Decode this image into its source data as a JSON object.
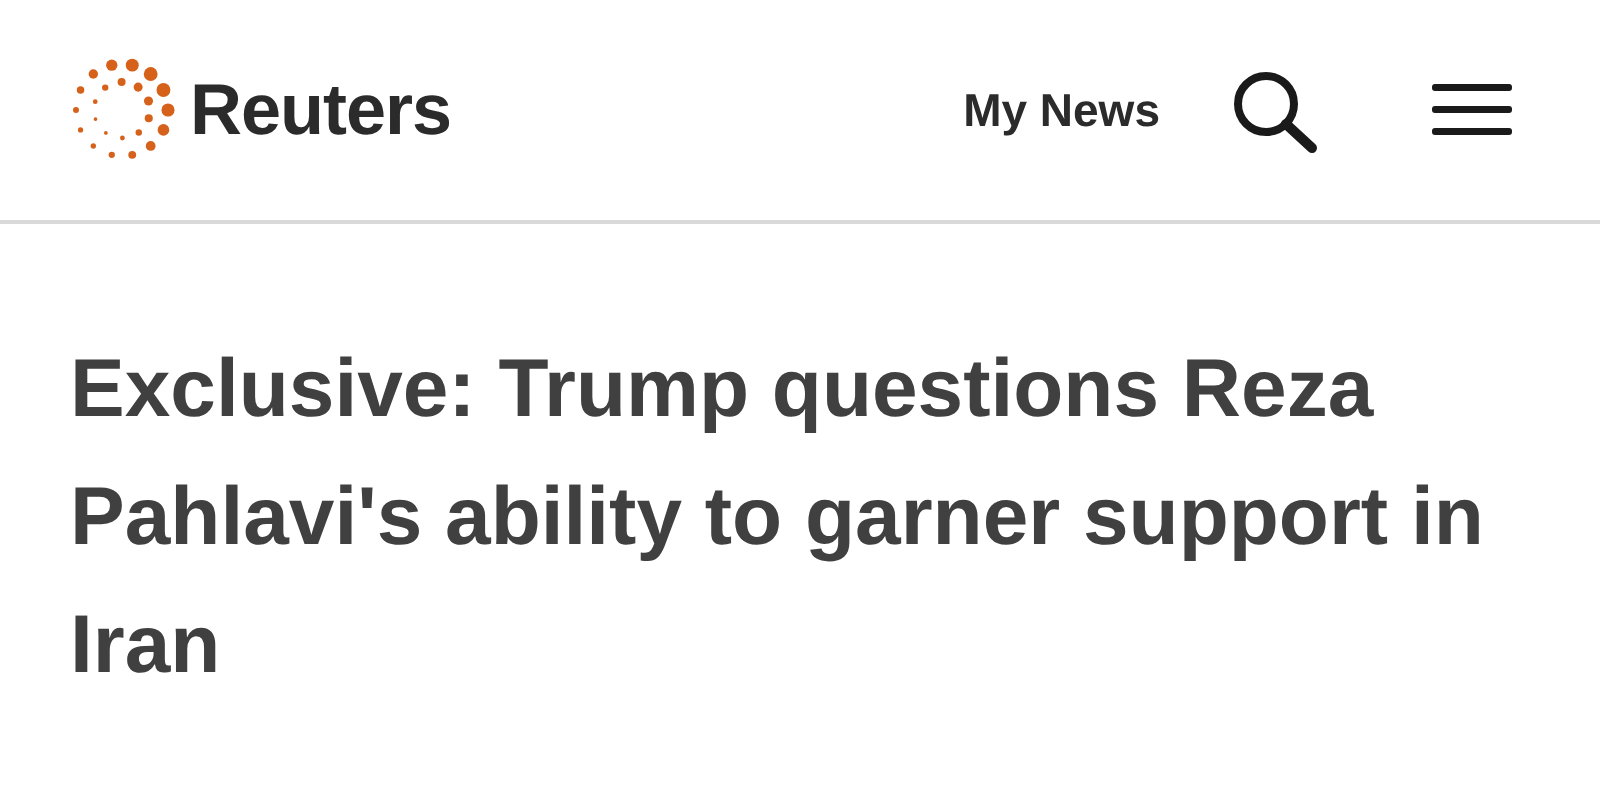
{
  "header": {
    "brand": "Reuters",
    "nav_link": "My News"
  },
  "article": {
    "headline": "Exclusive: Trump questions Reza Pahlavi's ability to garner support in Iran"
  }
}
